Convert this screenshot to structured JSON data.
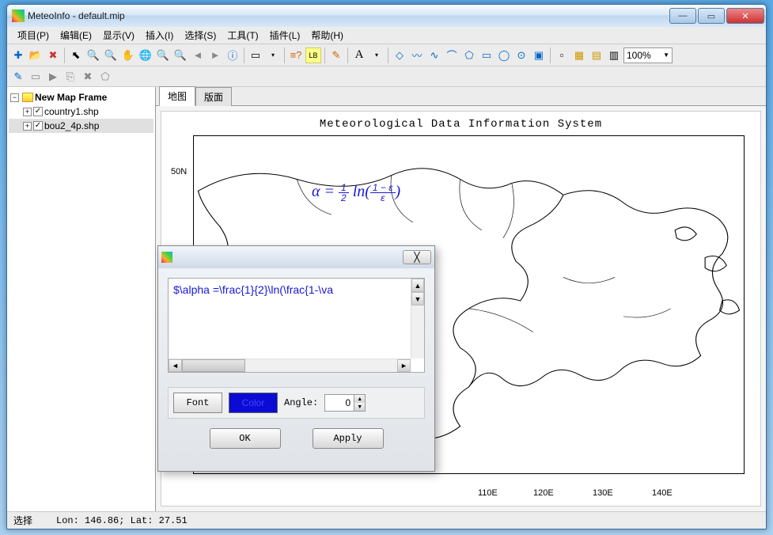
{
  "window": {
    "title": "MeteoInfo - default.mip"
  },
  "menu": {
    "items": [
      "项目(P)",
      "编辑(E)",
      "显示(V)",
      "插入(I)",
      "选择(S)",
      "工具(T)",
      "插件(L)",
      "帮助(H)"
    ]
  },
  "toolbar": {
    "zoom_value": "100%"
  },
  "tree": {
    "root": "New Map Frame",
    "children": [
      {
        "label": "country1.shp",
        "checked": true,
        "selected": false
      },
      {
        "label": "bou2_4p.shp",
        "checked": true,
        "selected": true
      }
    ]
  },
  "tabs": {
    "items": [
      "地图",
      "版面"
    ],
    "active": 0
  },
  "map": {
    "title": "Meteorological Data Information System",
    "formula_html": "α = <span style='display:inline-block;vertical-align:middle;text-align:center;line-height:1'><span style='display:block;border-bottom:1px solid #1818d8;padding:0 3px'>1</span><span style='display:block;padding:0 3px'>2</span></span> ln(<span style='display:inline-block;vertical-align:middle;text-align:center;line-height:1'><span style='display:block;border-bottom:1px solid #1818d8;padding:0 3px'>1 − ε</span><span style='display:block;padding:0 3px'>ε</span></span>)",
    "y_ticks": [
      "50N"
    ],
    "x_ticks": [
      "110E",
      "120E",
      "130E",
      "140E"
    ]
  },
  "dialog": {
    "text": "$\\alpha =\\frac{1}{2}\\ln(\\frac{1-\\va",
    "font_btn": "Font",
    "color_btn": "Color",
    "angle_label": "Angle:",
    "angle_value": "0",
    "ok": "OK",
    "apply": "Apply"
  },
  "status": {
    "mode": "选择",
    "coords": "Lon: 146.86; Lat: 27.51"
  }
}
